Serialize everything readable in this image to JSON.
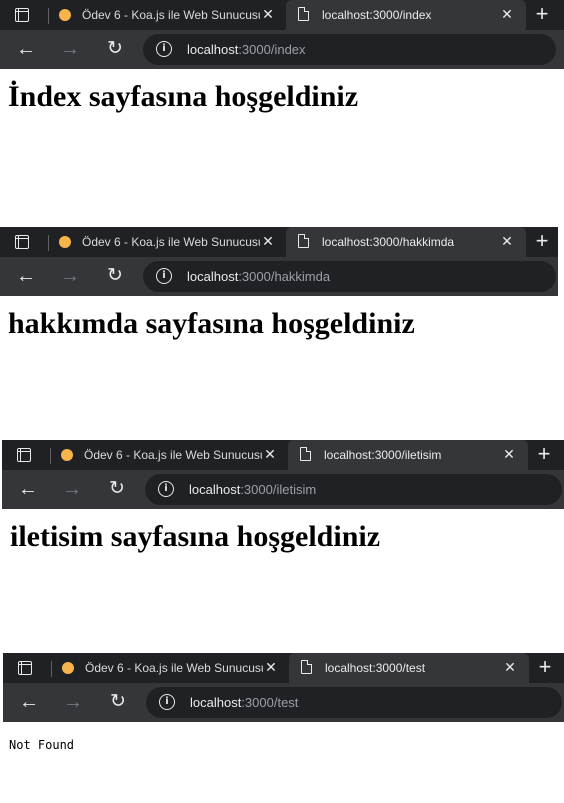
{
  "windows": [
    {
      "tabs": [
        {
          "title": "Ödev 6 - Koa.js ile Web Sunucusu",
          "active": false
        },
        {
          "title": "localhost:3000/index",
          "active": true
        }
      ],
      "url_host": "localhost",
      "url_rest": ":3000/index",
      "content": "İndex sayfasına hoşgeldiniz"
    },
    {
      "tabs": [
        {
          "title": "Ödev 6 - Koa.js ile Web Sunucusu",
          "active": false
        },
        {
          "title": "localhost:3000/hakkimda",
          "active": true
        }
      ],
      "url_host": "localhost",
      "url_rest": ":3000/hakkimda",
      "content": "hakkımda sayfasına hoşgeldiniz"
    },
    {
      "tabs": [
        {
          "title": "Ödev 6 - Koa.js ile Web Sunucusu",
          "active": false
        },
        {
          "title": "localhost:3000/iletisim",
          "active": true
        }
      ],
      "url_host": "localhost",
      "url_rest": ":3000/iletisim",
      "content": "iletisim sayfasına hoşgeldiniz"
    },
    {
      "tabs": [
        {
          "title": "Ödev 6 - Koa.js ile Web Sunucusu",
          "active": false
        },
        {
          "title": "localhost:3000/test",
          "active": true
        }
      ],
      "url_host": "localhost",
      "url_rest": ":3000/test",
      "content": "Not Found"
    }
  ],
  "icons": {
    "workspaces": "workspaces-icon",
    "favicon_koa": "orange-circle-favicon",
    "favicon_page": "page-icon",
    "close": "close-icon",
    "new_tab": "plus-icon",
    "back": "arrow-left-icon",
    "forward": "arrow-right-icon",
    "reload": "reload-icon",
    "site_info": "info-icon"
  },
  "colors": {
    "tab_strip": "#202124",
    "toolbar": "#35363a",
    "favicon_koa": "#f6b44a"
  }
}
